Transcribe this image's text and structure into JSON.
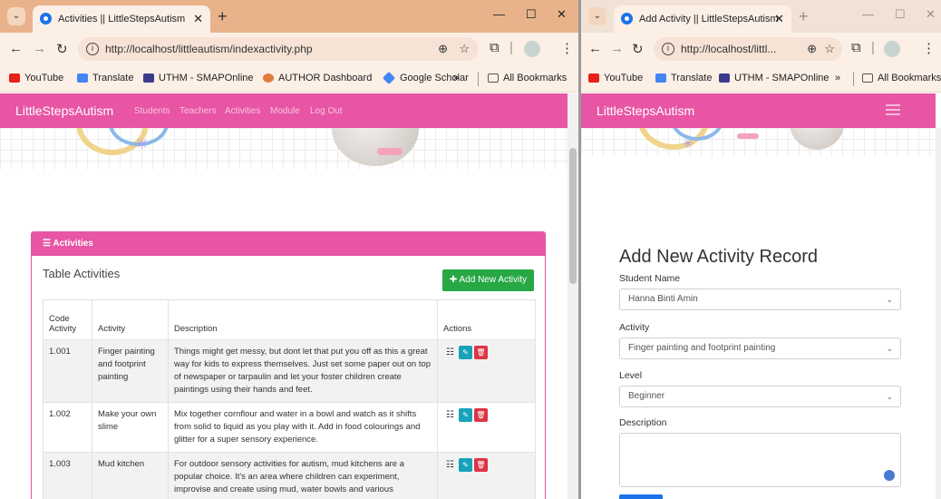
{
  "left": {
    "tab_title": "Activities || LittleStepsAutism",
    "url": "http://localhost/littleautism/indexactivity.php",
    "bookmarks": [
      "YouTube",
      "Translate",
      "UTHM - SMAPOnline",
      "AUTHOR Dashboard",
      "Google Scholar"
    ],
    "bookmarks_overflow": "»",
    "all_bookmarks": "All Bookmarks",
    "brand": "LittleStepsAutism",
    "nav": [
      "Students",
      "Teachers",
      "Activities",
      "Module",
      "Log Out"
    ],
    "card_header": "Activities",
    "table_title": "Table Activities",
    "add_button": "Add New Activity",
    "columns": [
      "Code Activity",
      "Activity",
      "Description",
      "Actions"
    ],
    "rows": [
      {
        "code": "1.001",
        "activity": "Finger painting and footprint painting",
        "description": "Things might get messy, but dont let that put you off as this a great way for kids to express themselves. Just set some paper out on top of newspaper or tarpaulin and let your foster children create paintings using their hands and feet."
      },
      {
        "code": "1.002",
        "activity": "Make your own slime",
        "description": "Mix together cornflour and water in a bowl and watch as it shifts from solid to liquid as you play with it. Add in food colourings and glitter for a super sensory experience."
      },
      {
        "code": "1.003",
        "activity": "Mud kitchen",
        "description": "For outdoor sensory activities for autism, mud kitchens are a popular choice. It's an area where children can experiment, improvise and create using mud, water bowls and various"
      }
    ]
  },
  "right": {
    "tab_title": "Add Activity || LittleStepsAutism",
    "url": "http://localhost/littl...",
    "bookmarks": [
      "YouTube",
      "Translate",
      "UTHM - SMAPOnline"
    ],
    "bookmarks_overflow": "»",
    "all_bookmarks": "All Bookmarks",
    "brand": "LittleStepsAutism",
    "form_title": "Add New Activity Record",
    "student_label": "Student Name",
    "student_value": "Hanna Binti Amin",
    "activity_label": "Activity",
    "activity_value": "Finger painting and footprint painting",
    "level_label": "Level",
    "level_value": "Beginner",
    "description_label": "Description"
  },
  "colors": {
    "brand_pink": "#e755a4",
    "tab_orange": "#e8b38a",
    "success_green": "#28a745",
    "edit_teal": "#17a2b8",
    "delete_red": "#dc3545"
  },
  "icons": {
    "tab_search": "chevron-down-icon",
    "minimize": "minimize-icon",
    "maximize": "maximize-icon",
    "close": "close-icon"
  }
}
